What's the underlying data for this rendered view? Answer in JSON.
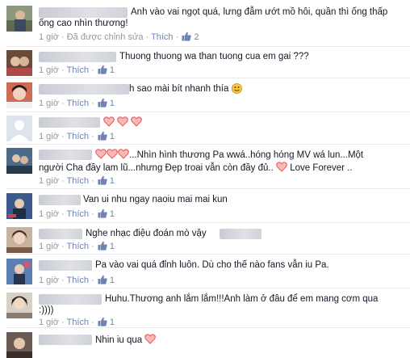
{
  "comments": [
    {
      "text_line1": "Anh vào vai ngọt quá, lưng đẫm ướt mồ hôi, quần thì ống thấp",
      "text_line2": "ống cao nhìn thương!",
      "time": "1 giờ",
      "edited": "Đã được chỉnh sửa",
      "like_label": "Thích",
      "like_count": "2"
    },
    {
      "text_line1": "Thuong thuong wa than tuong cua em gai ???",
      "time": "1 giờ",
      "like_label": "Thích",
      "like_count": "1"
    },
    {
      "text_line1": "h sao mài bít nhanh thía",
      "time": "1 giờ",
      "like_label": "Thích",
      "like_count": "1"
    },
    {
      "time": "1 giờ",
      "like_label": "Thích",
      "like_count": "1"
    },
    {
      "text_line1": "...Nhìn hình thương Pa wwá..hóng hóng MV wá lun...Một",
      "text_line2": "người Cha đầy lam lũ...nhưng Đẹp troai vẫn còn đầy đủ..",
      "text_line2b": "Love Forever ..",
      "time": "1 giờ",
      "like_label": "Thích",
      "like_count": "1"
    },
    {
      "text_line1": "Van ui nhu ngay naoiu mai mai kun",
      "time": "1 giờ",
      "like_label": "Thích",
      "like_count": "1"
    },
    {
      "text_line1": "Nghe nhạc điệu đoán mò vậy",
      "time": "1 giờ",
      "like_label": "Thích",
      "like_count": "1"
    },
    {
      "text_line1": "Pa vào vai quá đỉnh luôn. Dù cho thế nào fans vẫn iu Pa.",
      "time": "1 giờ",
      "like_label": "Thích",
      "like_count": "1"
    },
    {
      "text_line1": "Huhu.Thương anh lắm lắm!!!Anh làm ở đâu để em mang cơm qua",
      "text_line2": ":))))",
      "time": "1 giờ",
      "like_label": "Thích",
      "like_count": "1"
    },
    {
      "text_line1": "Nhin iu qua"
    }
  ],
  "colors": {
    "link": "#6d84b4",
    "meta": "#9197a3",
    "text": "#141823",
    "heart": "#e8585a",
    "divider": "#e9eaed"
  },
  "icons": [
    "like-icon",
    "heart-emoticon",
    "smile-emoticon",
    "avatar-photo",
    "avatar-default-silhouette"
  ]
}
